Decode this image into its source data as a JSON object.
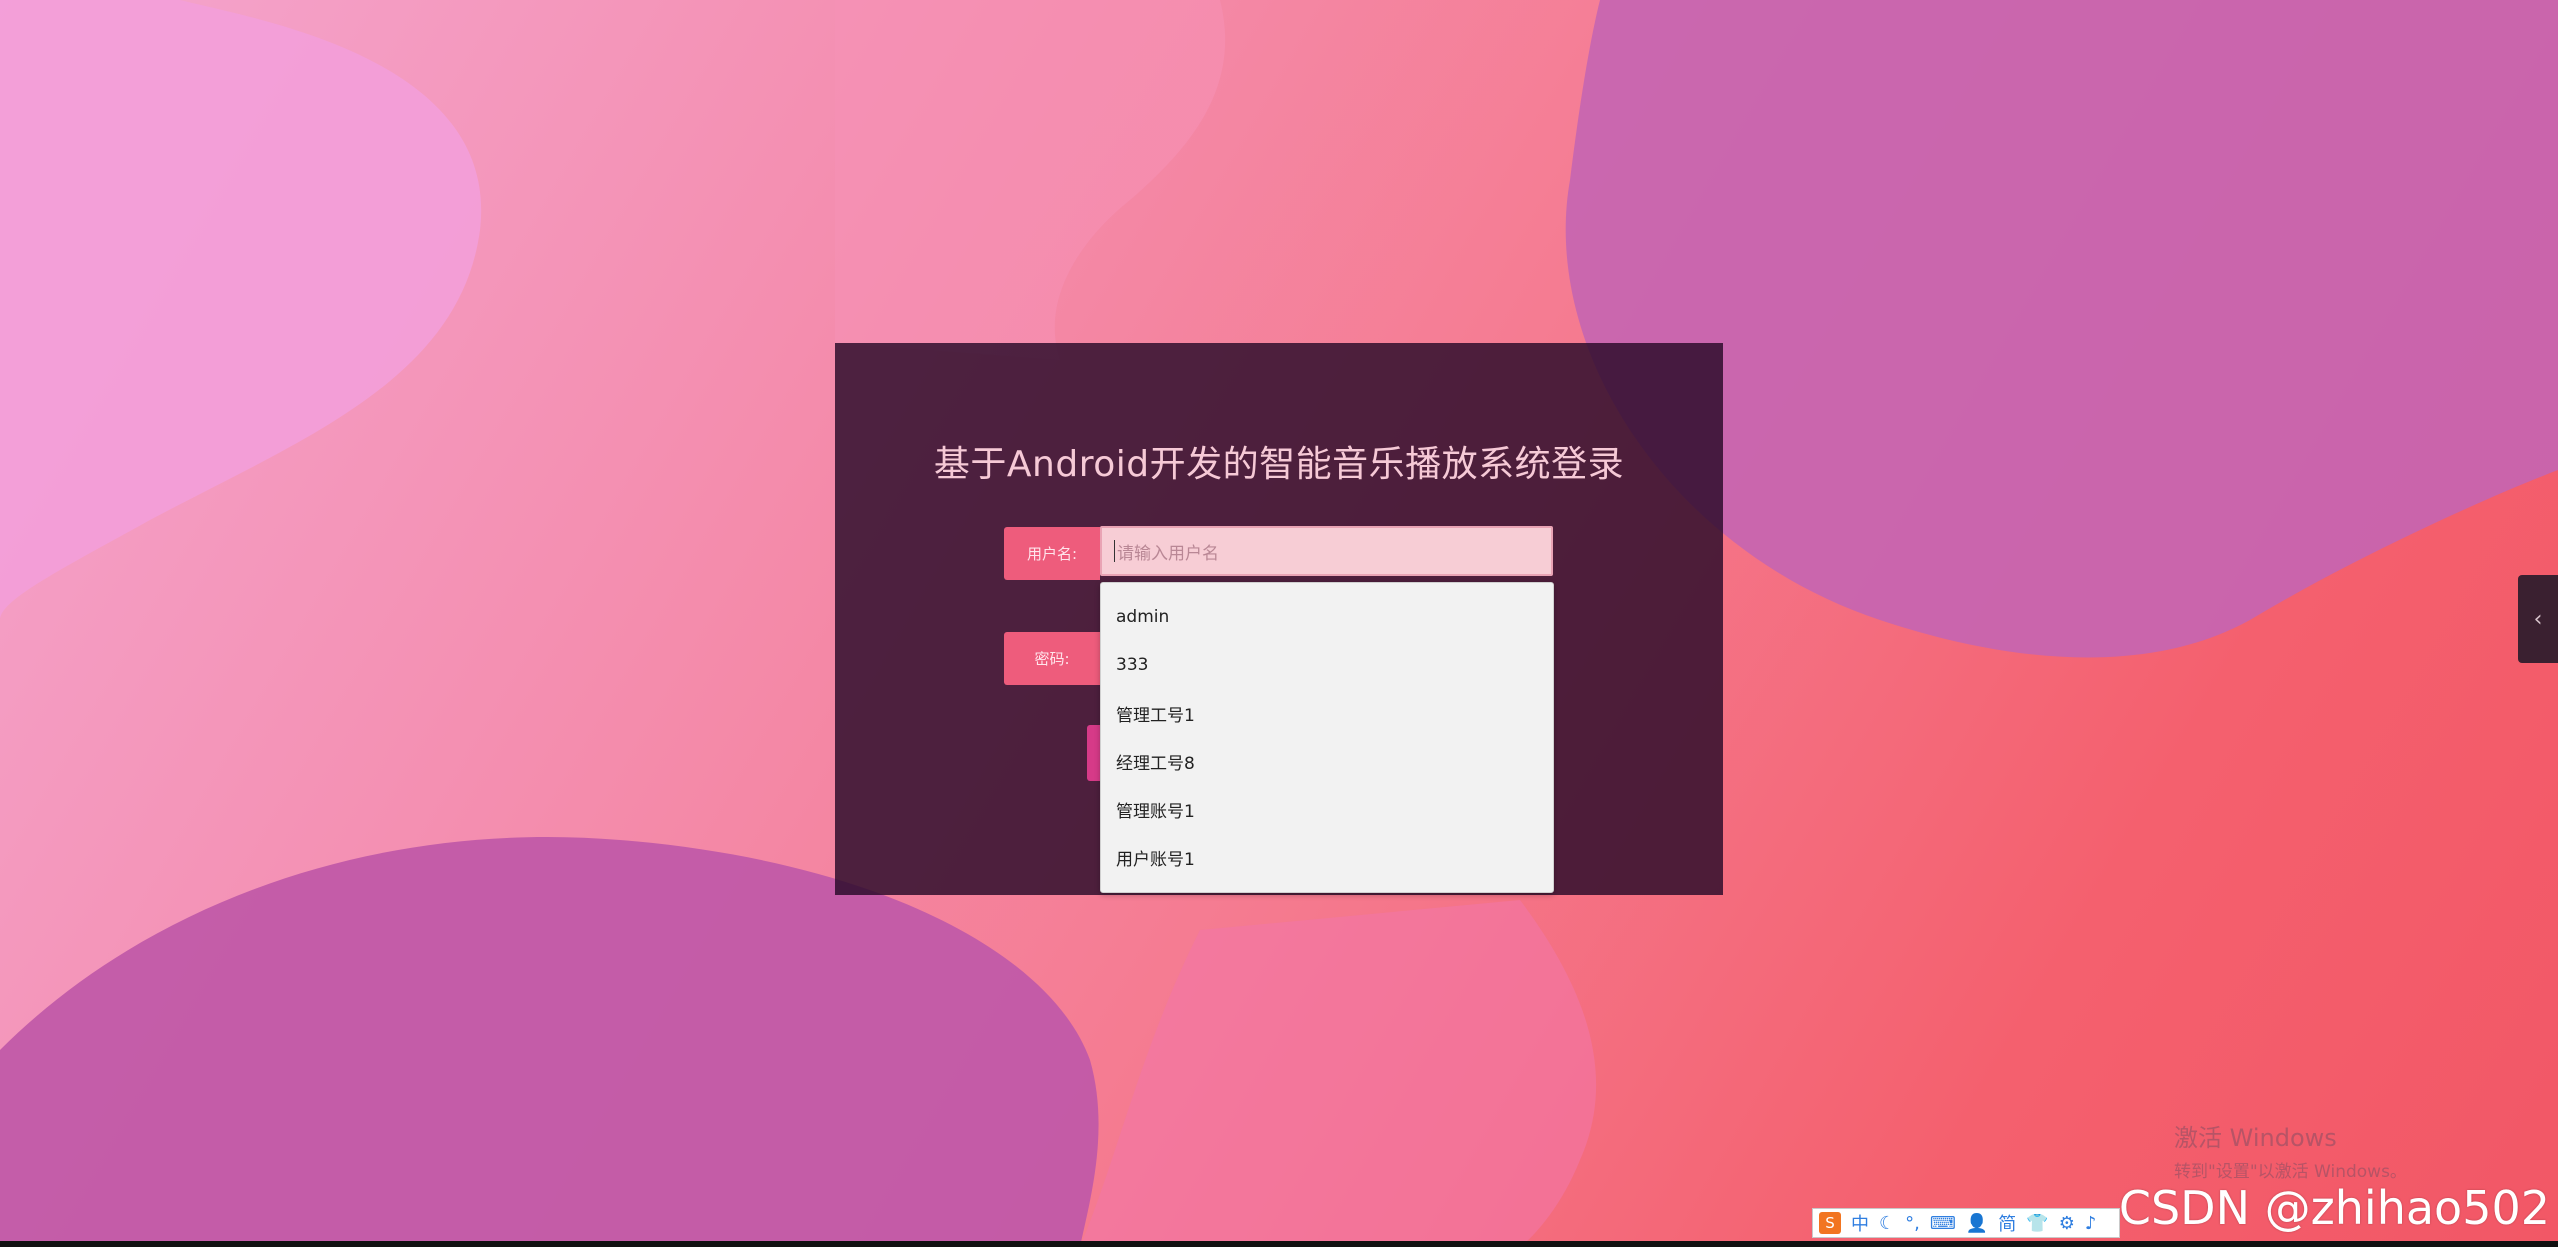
{
  "login": {
    "title": "基于Android开发的智能音乐播放系统登录",
    "username_label": "用户名:",
    "username_placeholder": "请输入用户名",
    "password_label": "密码:"
  },
  "autocomplete": {
    "items": [
      "admin",
      "333",
      "管理工号1",
      "经理工号8",
      "管理账号1",
      "用户账号1"
    ]
  },
  "side_tab": {
    "icon": "chevron-left-icon",
    "glyph": "‹"
  },
  "watermark": {
    "line1": "激活 Windows",
    "line2": "转到\"设置\"以激活 Windows。"
  },
  "csdn": {
    "text": "CSDN @zhihao502"
  },
  "ime": {
    "logo": "S",
    "glyphs": [
      "中",
      "☾",
      "°,",
      "⌨",
      "👤",
      "简",
      "👕",
      "⚙",
      "♪"
    ]
  },
  "colors": {
    "panel": "#280a28",
    "label_bg": "#ee5c7c",
    "input_bg": "#f7cdd5",
    "button": "#d63a88"
  }
}
